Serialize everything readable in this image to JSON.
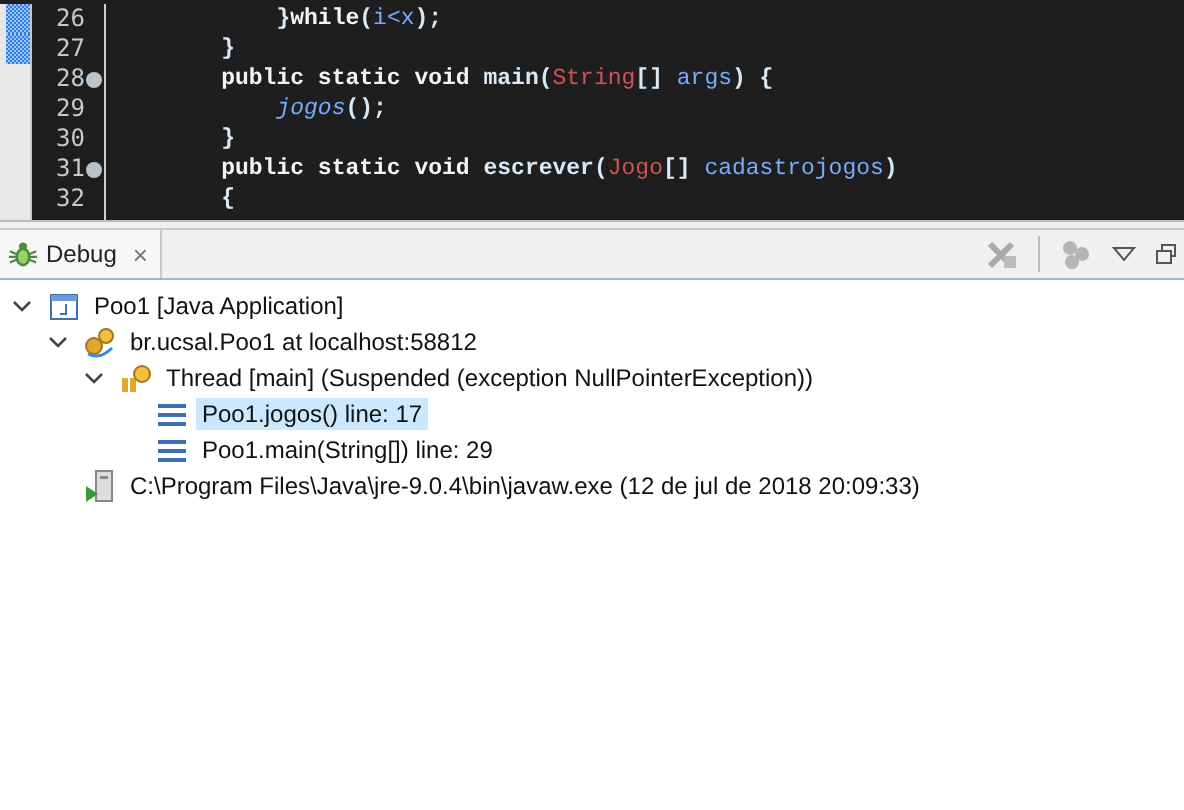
{
  "editor": {
    "lines": [
      {
        "number": "26",
        "marked": true,
        "fold": false,
        "tokens": [
          {
            "kind": "plain",
            "text": "        }"
          },
          {
            "kind": "keyword",
            "text": "while"
          },
          {
            "kind": "plain",
            "text": "("
          },
          {
            "kind": "var",
            "text": "i<x"
          },
          {
            "kind": "plain",
            "text": ");"
          }
        ]
      },
      {
        "number": "27",
        "marked": true,
        "fold": false,
        "tokens": [
          {
            "kind": "plain",
            "text": "    }"
          }
        ]
      },
      {
        "number": "28",
        "marked": false,
        "fold": true,
        "tokens": [
          {
            "kind": "keyword",
            "text": "    public static void "
          },
          {
            "kind": "plain",
            "text": "main("
          },
          {
            "kind": "type",
            "text": "String"
          },
          {
            "kind": "plain",
            "text": "[] "
          },
          {
            "kind": "var",
            "text": "args"
          },
          {
            "kind": "plain",
            "text": ") {"
          }
        ]
      },
      {
        "number": "29",
        "marked": false,
        "fold": false,
        "tokens": [
          {
            "kind": "static-call",
            "text": "        jogos"
          },
          {
            "kind": "plain",
            "text": "();"
          }
        ]
      },
      {
        "number": "30",
        "marked": false,
        "fold": false,
        "tokens": [
          {
            "kind": "plain",
            "text": "    }"
          }
        ]
      },
      {
        "number": "31",
        "marked": false,
        "fold": true,
        "tokens": [
          {
            "kind": "keyword",
            "text": "    public static void "
          },
          {
            "kind": "plain",
            "text": "escrever("
          },
          {
            "kind": "type",
            "text": "Jogo"
          },
          {
            "kind": "plain",
            "text": "[] "
          },
          {
            "kind": "var",
            "text": "cadastrojogos"
          },
          {
            "kind": "plain",
            "text": ")"
          }
        ]
      },
      {
        "number": "32",
        "marked": false,
        "fold": false,
        "tokens": [
          {
            "kind": "plain",
            "text": "    {"
          }
        ]
      }
    ]
  },
  "debug_view": {
    "tab": {
      "label": "Debug",
      "close": "×",
      "selected": true
    },
    "tree": [
      {
        "kind": "application",
        "label": "Poo1 [Java Application]",
        "expanded": true,
        "selected": false,
        "children": [
          {
            "kind": "vm",
            "label": "br.ucsal.Poo1 at localhost:58812",
            "expanded": true,
            "selected": false,
            "children": [
              {
                "kind": "thread",
                "label": "Thread [main] (Suspended (exception NullPointerException))",
                "expanded": true,
                "selected": false,
                "children": [
                  {
                    "kind": "frame",
                    "label": "Poo1.jogos() line: 17",
                    "selected": true
                  },
                  {
                    "kind": "frame",
                    "label": "Poo1.main(String[]) line: 29",
                    "selected": false
                  }
                ]
              }
            ]
          },
          {
            "kind": "process",
            "label": "C:\\Program Files\\Java\\jre-9.0.4\\bin\\javaw.exe (12 de jul de 2018 20:09:33)",
            "selected": false
          }
        ]
      }
    ]
  }
}
